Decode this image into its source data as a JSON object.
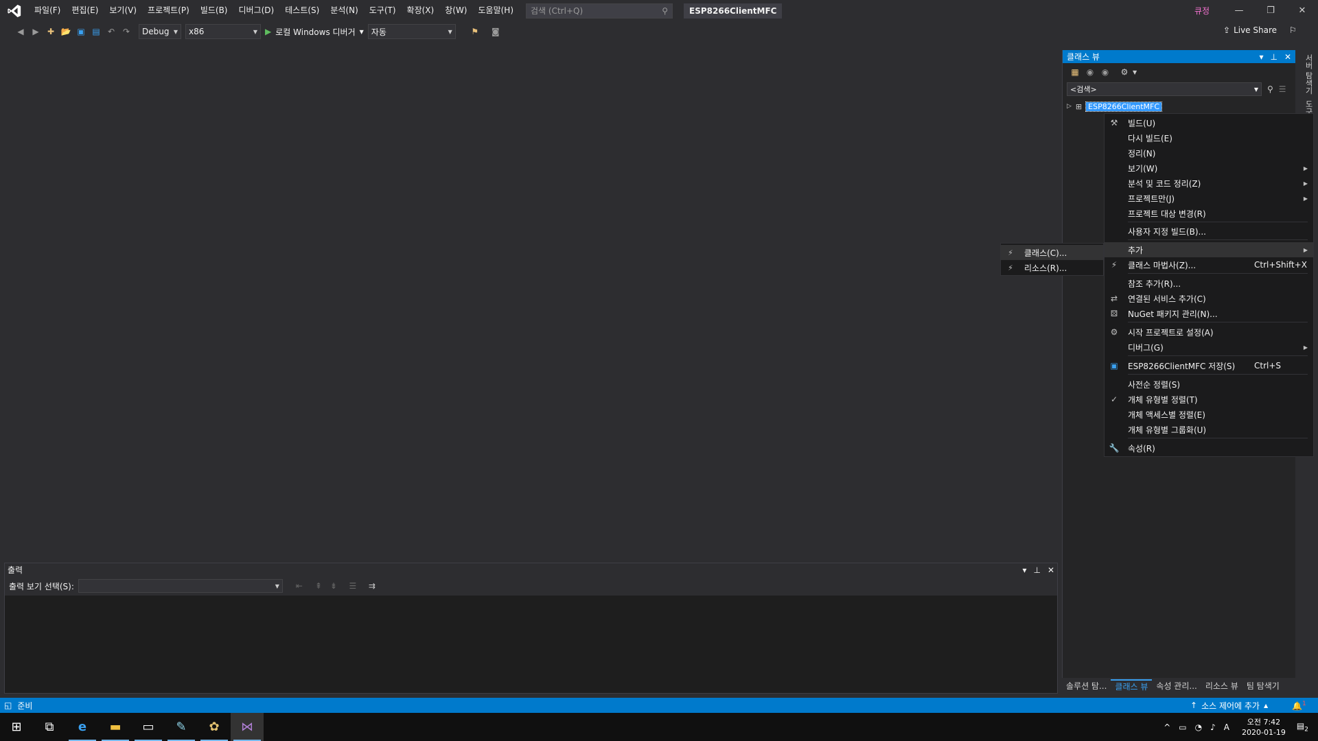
{
  "titlebar": {
    "menus": [
      "파일(F)",
      "편집(E)",
      "보기(V)",
      "프로젝트(P)",
      "빌드(B)",
      "디버그(D)",
      "테스트(S)",
      "분석(N)",
      "도구(T)",
      "확장(X)",
      "창(W)",
      "도움말(H)"
    ],
    "search_placeholder": "검색 (Ctrl+Q)",
    "solution_name": "ESP8266ClientMFC",
    "user_badge": "큐정"
  },
  "toolbar": {
    "config": "Debug",
    "platform": "x86",
    "start_label": "로컬 Windows 디버거",
    "mode": "자동",
    "liveshare": "Live Share"
  },
  "classview": {
    "title": "클래스 뷰",
    "search_placeholder": "<검색>",
    "project_node": "ESP8266ClientMFC",
    "bottom_tabs": [
      "솔루션 탐...",
      "클래스 뷰",
      "속성 관리...",
      "리소스 뷰",
      "팀 탐색기"
    ],
    "side_tabs": [
      "서버 탐색기",
      "도구"
    ]
  },
  "context_menu": {
    "items": [
      {
        "label": "빌드(U)",
        "icon": "build-icon"
      },
      {
        "label": "다시 빌드(E)"
      },
      {
        "label": "정리(N)"
      },
      {
        "label": "보기(W)",
        "submenu": true
      },
      {
        "label": "분석 및 코드 정리(Z)",
        "submenu": true
      },
      {
        "label": "프로젝트만(J)",
        "submenu": true
      },
      {
        "label": "프로젝트 대상 변경(R)"
      },
      {
        "label": "사용자 지정 빌드(B)..."
      },
      {
        "label": "추가",
        "submenu": true,
        "highlighted": true
      },
      {
        "label": "클래스 마법사(Z)...",
        "shortcut": "Ctrl+Shift+X",
        "icon": "wizard-icon"
      },
      {
        "label": "참조 추가(R)..."
      },
      {
        "label": "연결된 서비스 추가(C)",
        "icon": "connected-service-icon"
      },
      {
        "label": "NuGet 패키지 관리(N)...",
        "icon": "nuget-icon"
      },
      {
        "label": "시작 프로젝트로 설정(A)",
        "icon": "gear-icon"
      },
      {
        "label": "디버그(G)",
        "submenu": true
      },
      {
        "label": "ESP8266ClientMFC 저장(S)",
        "shortcut": "Ctrl+S",
        "icon": "save-icon"
      },
      {
        "label": "사전순 정렬(S)"
      },
      {
        "label": "개체 유형별 정렬(T)",
        "checked": true
      },
      {
        "label": "개체 액세스별 정렬(E)"
      },
      {
        "label": "개체 유형별 그룹화(U)"
      },
      {
        "label": "속성(R)",
        "icon": "wrench-icon"
      }
    ]
  },
  "submenu": {
    "items": [
      "클래스(C)...",
      "리소스(R)..."
    ]
  },
  "output": {
    "title": "출력",
    "show_from_label": "출력 보기 선택(S):"
  },
  "statusbar": {
    "status": "준비",
    "source_control": "소스 제어에 추가",
    "notifications": "1"
  },
  "taskbar": {
    "time": "오전 7:42",
    "date": "2020-01-19",
    "ime": "A",
    "notification_count": "2"
  }
}
